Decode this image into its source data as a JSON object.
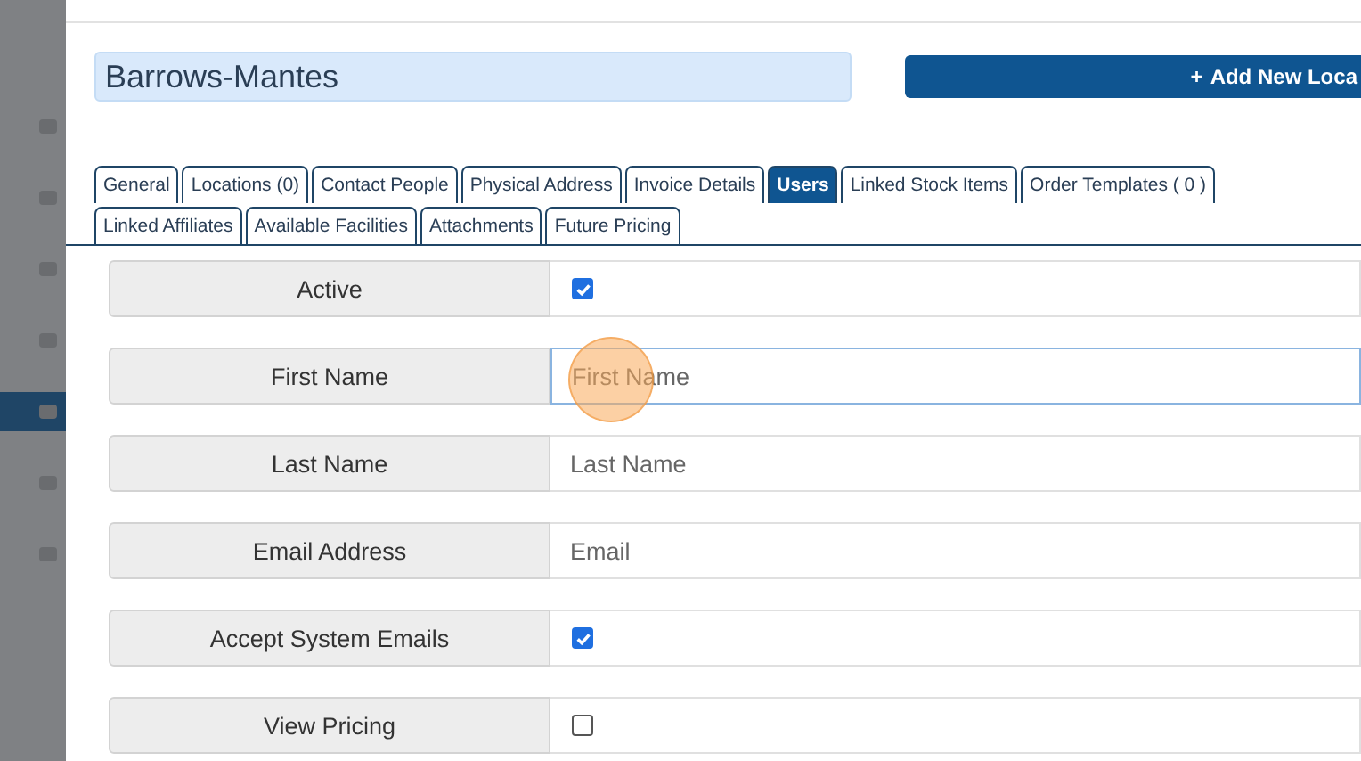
{
  "sidebar": {
    "items": [
      {
        "selected": false
      },
      {
        "selected": false
      },
      {
        "selected": false
      },
      {
        "selected": false
      },
      {
        "selected": true
      },
      {
        "selected": false
      },
      {
        "selected": false
      }
    ]
  },
  "record_name": "Barrows-Mantes",
  "add_button": {
    "icon": "+",
    "label": "Add New Loca"
  },
  "tabs": [
    {
      "label": "General",
      "selected": false
    },
    {
      "label": "Locations (0)",
      "selected": false
    },
    {
      "label": "Contact People",
      "selected": false
    },
    {
      "label": "Physical Address",
      "selected": false
    },
    {
      "label": "Invoice Details",
      "selected": false
    },
    {
      "label": "Users",
      "selected": true
    },
    {
      "label": "Linked Stock Items",
      "selected": false
    },
    {
      "label": "Order Templates ( 0 )",
      "selected": false
    },
    {
      "label": "Linked Affiliates",
      "selected": false
    },
    {
      "label": "Available Facilities",
      "selected": false
    },
    {
      "label": "Attachments",
      "selected": false
    },
    {
      "label": "Future Pricing",
      "selected": false
    }
  ],
  "form_rows": [
    {
      "kind": "checkbox",
      "label": "Active",
      "checked": true
    },
    {
      "kind": "text",
      "label": "First Name",
      "placeholder": "First Name",
      "focused": true
    },
    {
      "kind": "text",
      "label": "Last Name",
      "placeholder": "Last Name",
      "focused": false
    },
    {
      "kind": "text",
      "label": "Email Address",
      "placeholder": "Email",
      "focused": false
    },
    {
      "kind": "checkbox",
      "label": "Accept System Emails",
      "checked": true
    },
    {
      "kind": "checkbox",
      "label": "View Pricing",
      "checked": false
    }
  ]
}
